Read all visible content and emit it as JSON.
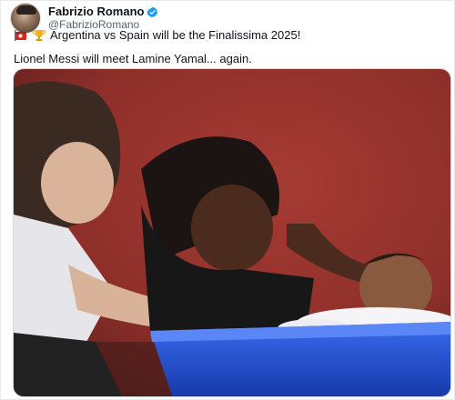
{
  "author": {
    "display_name": "Fabrizio Romano",
    "handle": "@FabrizioRomano",
    "verified_color": "#1d9bf0"
  },
  "tweet": {
    "line1_icons": [
      "flag-icon",
      "trophy-icon"
    ],
    "line1": "Argentina vs Spain will be the Finalissima 2025!",
    "line2": "Lionel Messi will meet Lamine Yamal... again."
  },
  "media": {
    "type": "photo",
    "icon": "photo"
  },
  "colors": {
    "text": "#0f1419",
    "handle": "#536471",
    "photo_wall": "#8f2f2a",
    "tub": "#1f4fd6"
  }
}
